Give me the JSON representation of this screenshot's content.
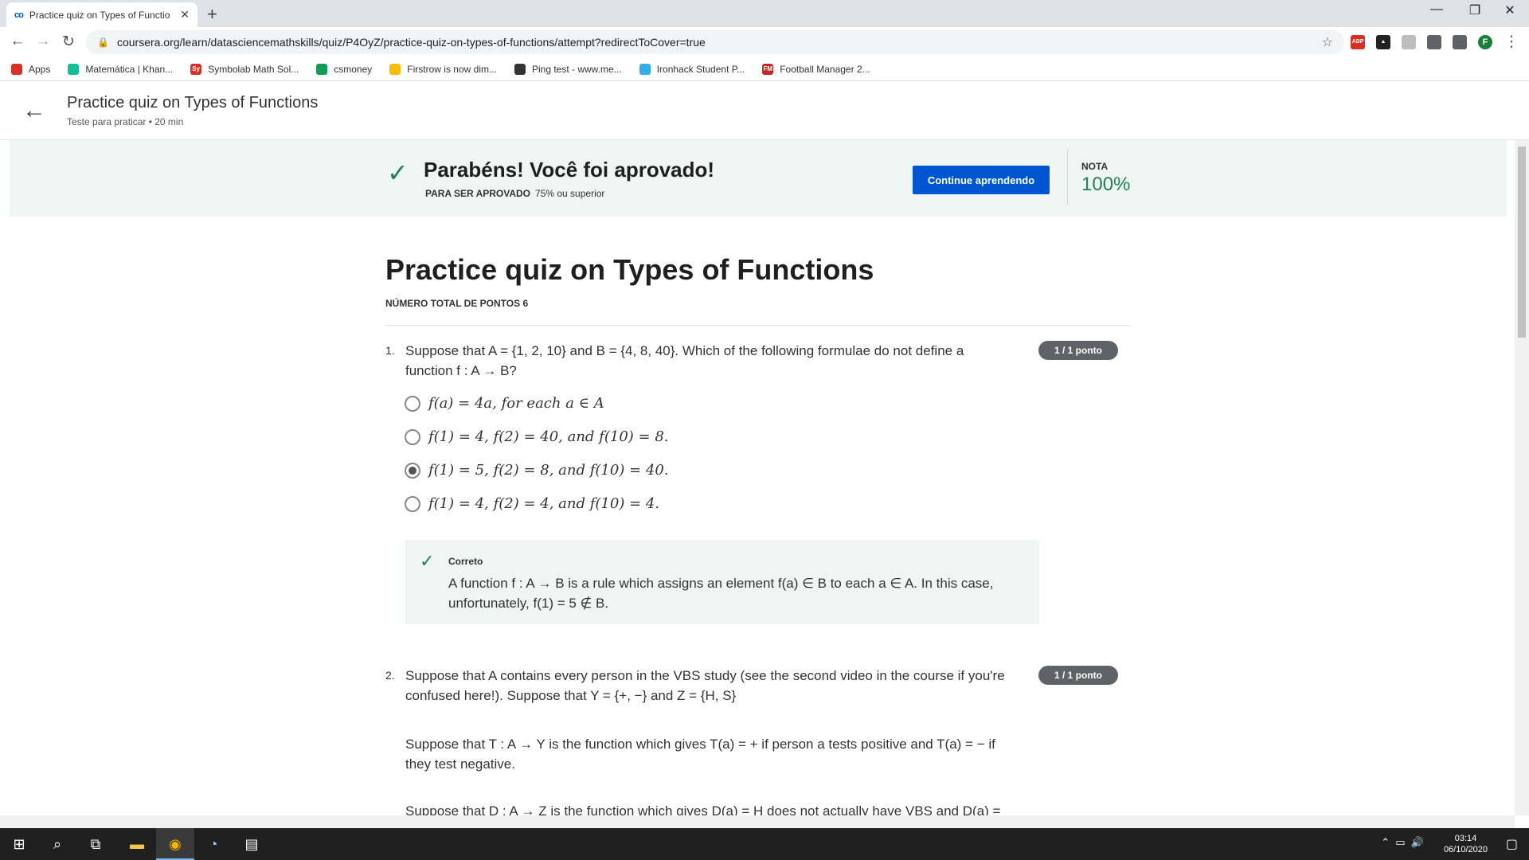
{
  "browser": {
    "tab_title": "Practice quiz on Types of Functio",
    "tab_favicon": "co",
    "url": "coursera.org/learn/datasciencemathskills/quiz/P4OyZ/practice-quiz-on-types-of-functions/attempt?redirectToCover=true",
    "bookmarks": [
      {
        "label": "Apps",
        "icon": "apps-grid-icon",
        "color": "#d93025"
      },
      {
        "label": "Matemática | Khan...",
        "icon": "khan-icon",
        "color": "#14bf96"
      },
      {
        "label": "Symbolab Math Sol...",
        "icon": "symbolab-icon",
        "color": "#d93025",
        "glyph": "Sy"
      },
      {
        "label": "csmoney",
        "icon": "csmoney-icon",
        "color": "#0f9d58"
      },
      {
        "label": "Firstrow is now dim...",
        "icon": "firstrow-icon",
        "color": "#fbbc05"
      },
      {
        "label": "Ping test - www.me...",
        "icon": "ping-icon",
        "color": "#333333"
      },
      {
        "label": "Ironhack Student P...",
        "icon": "ironhack-icon",
        "color": "#32aee8"
      },
      {
        "label": "Football Manager 2...",
        "icon": "fm-icon",
        "color": "#c62828",
        "glyph": "FM"
      }
    ],
    "extensions": [
      {
        "icon": "abp-icon",
        "glyph": "ABP",
        "color": "#d93025"
      },
      {
        "icon": "ext-dark-icon",
        "glyph": "▲",
        "color": "#222222"
      },
      {
        "icon": "shield-icon",
        "glyph": "",
        "color": "#bdbdbd"
      },
      {
        "icon": "puzzle-icon",
        "glyph": "",
        "color": "#5f6368"
      },
      {
        "icon": "media-icon",
        "glyph": "",
        "color": "#5f6368"
      },
      {
        "icon": "profile-avatar",
        "glyph": "F",
        "color": "#188038"
      }
    ]
  },
  "header": {
    "title": "Practice quiz on Types of Functions",
    "subtitle": "Teste para praticar • 20 min"
  },
  "banner": {
    "headline": "Parabéns! Você foi aprovado!",
    "pass_label": "PARA SER APROVADO",
    "pass_value": "75% ou superior",
    "button": "Continue aprendendo",
    "grade_label": "NOTA",
    "grade_value": "100%"
  },
  "quiz": {
    "title": "Practice quiz on Types of Functions",
    "total_points": "NÚMERO TOTAL DE PONTOS 6",
    "questions": [
      {
        "number": "1.",
        "badge": "1 / 1 ponto",
        "text_line1": "Suppose that A = {1, 2, 10} and B = {4, 8, 40}. Which of the following formulae do not define a",
        "text_line2": "function f : A → B?",
        "options": [
          {
            "text": "f(a) = 4a, for each a ∈ A",
            "selected": false
          },
          {
            "text": "f(1) = 4, f(2) = 40, and f(10) = 8.",
            "selected": false
          },
          {
            "text": "f(1) = 5, f(2) = 8, and f(10) = 40.",
            "selected": true
          },
          {
            "text": "f(1) = 4, f(2) = 4, and f(10) = 4.",
            "selected": false
          }
        ],
        "feedback_label": "Correto",
        "feedback_line1": "A function f : A → B is a rule which assigns an element f(a) ∈ B to each a ∈ A. In this case,",
        "feedback_line2": "unfortunately, f(1) = 5 ∉ B."
      },
      {
        "number": "2.",
        "badge": "1 / 1 ponto",
        "text_line1": "Suppose that A contains every person in the VBS study (see the second video in the course if you're",
        "text_line2": "confused here!). Suppose that Y = {+, −} and Z = {H, S}",
        "para2_line1": "Suppose that T : A → Y is the function which gives T(a) = + if person a tests positive and T(a) = − if",
        "para2_line2": "they test negative.",
        "para3_line1": "Suppose that D : A → Z is the function which gives D(a) = H does not actually have VBS and D(a) ="
      }
    ]
  },
  "taskbar": {
    "time": "03:14",
    "date": "06/10/2020"
  }
}
